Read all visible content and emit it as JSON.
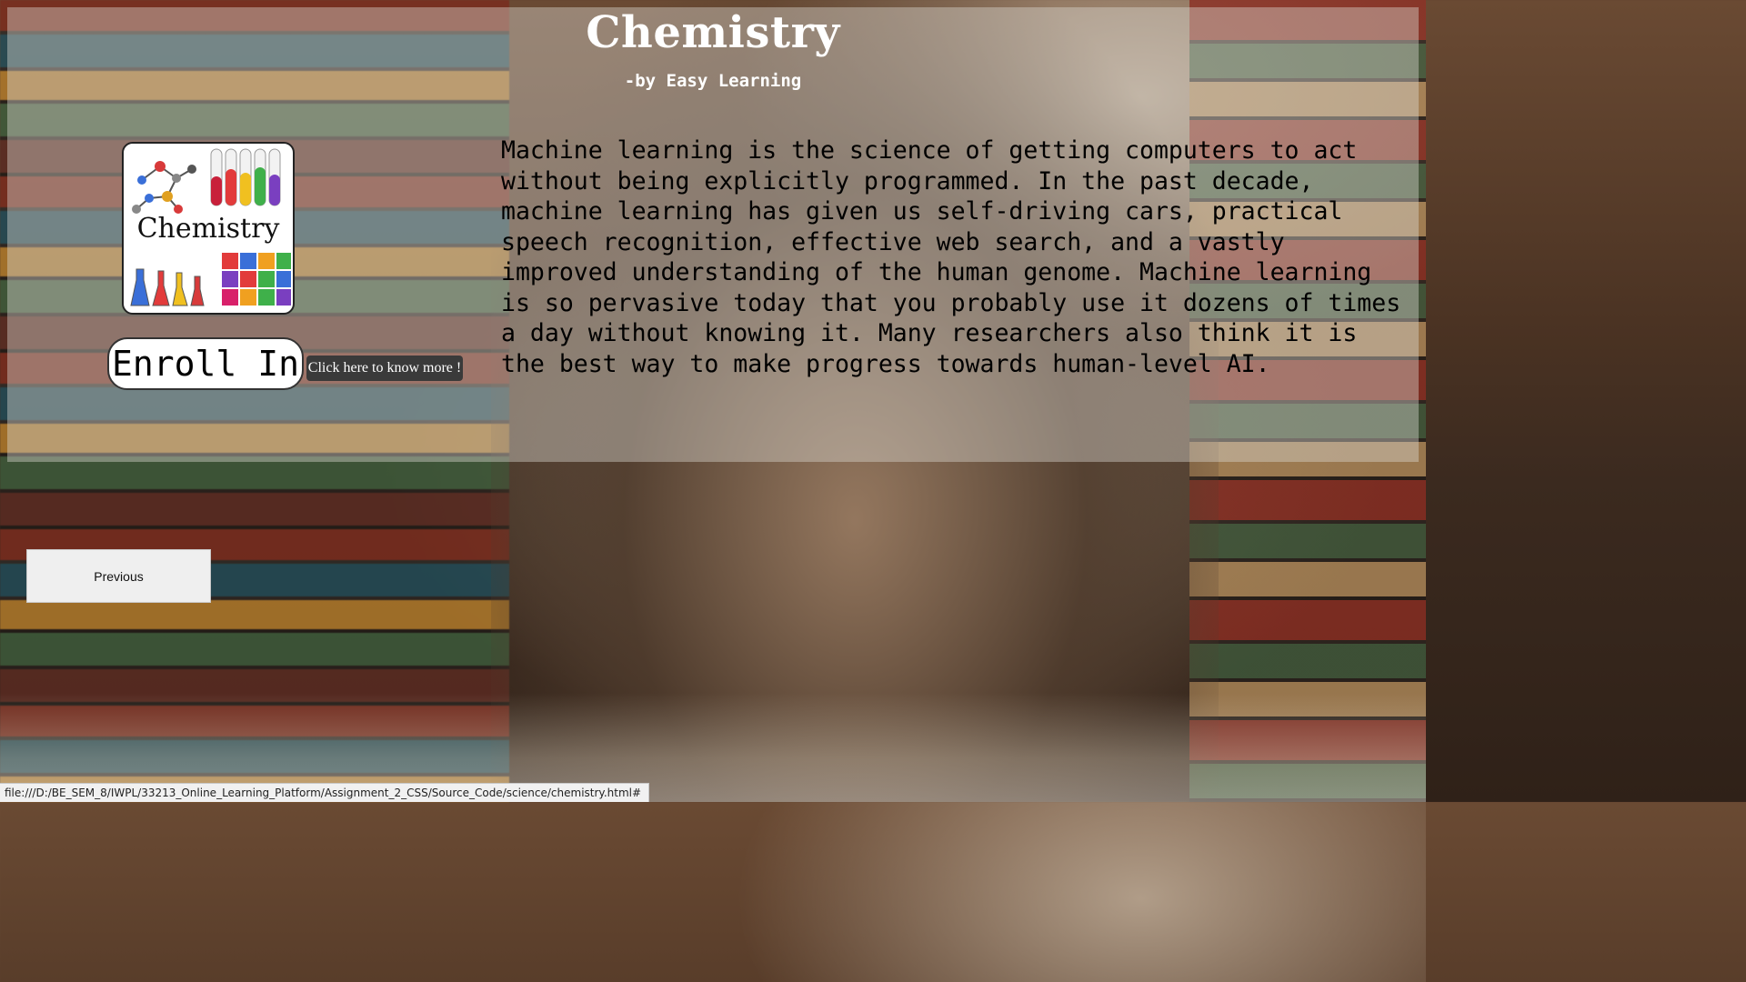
{
  "page": {
    "title": "Chemistry",
    "subtitle": "-by Easy Learning"
  },
  "course_image": {
    "icon": "chemistry-logo",
    "text": "Chemistry"
  },
  "actions": {
    "enroll_label": "Enroll In",
    "know_more_label": "Click here to know more !",
    "previous_label": "Previous"
  },
  "description": "Machine learning is the science of getting computers to act without being explicitly programmed. In the past decade, machine learning has given us self-driving cars, practical speech recognition, effective web search, and a vastly improved understanding of the human genome. Machine learning is so pervasive today that you probably use it dozens of times a day without knowing it. Many researchers also think it is the best way to make progress towards human-level AI.",
  "status_bar": {
    "url": "file:///D:/BE_SEM_8/IWPL/33213_Online_Learning_Platform/Assignment_2_CSS/Source_Code/science/chemistry.html#"
  },
  "colors": {
    "panel": "#dcdad2",
    "button_dark": "#3a3a3a"
  }
}
